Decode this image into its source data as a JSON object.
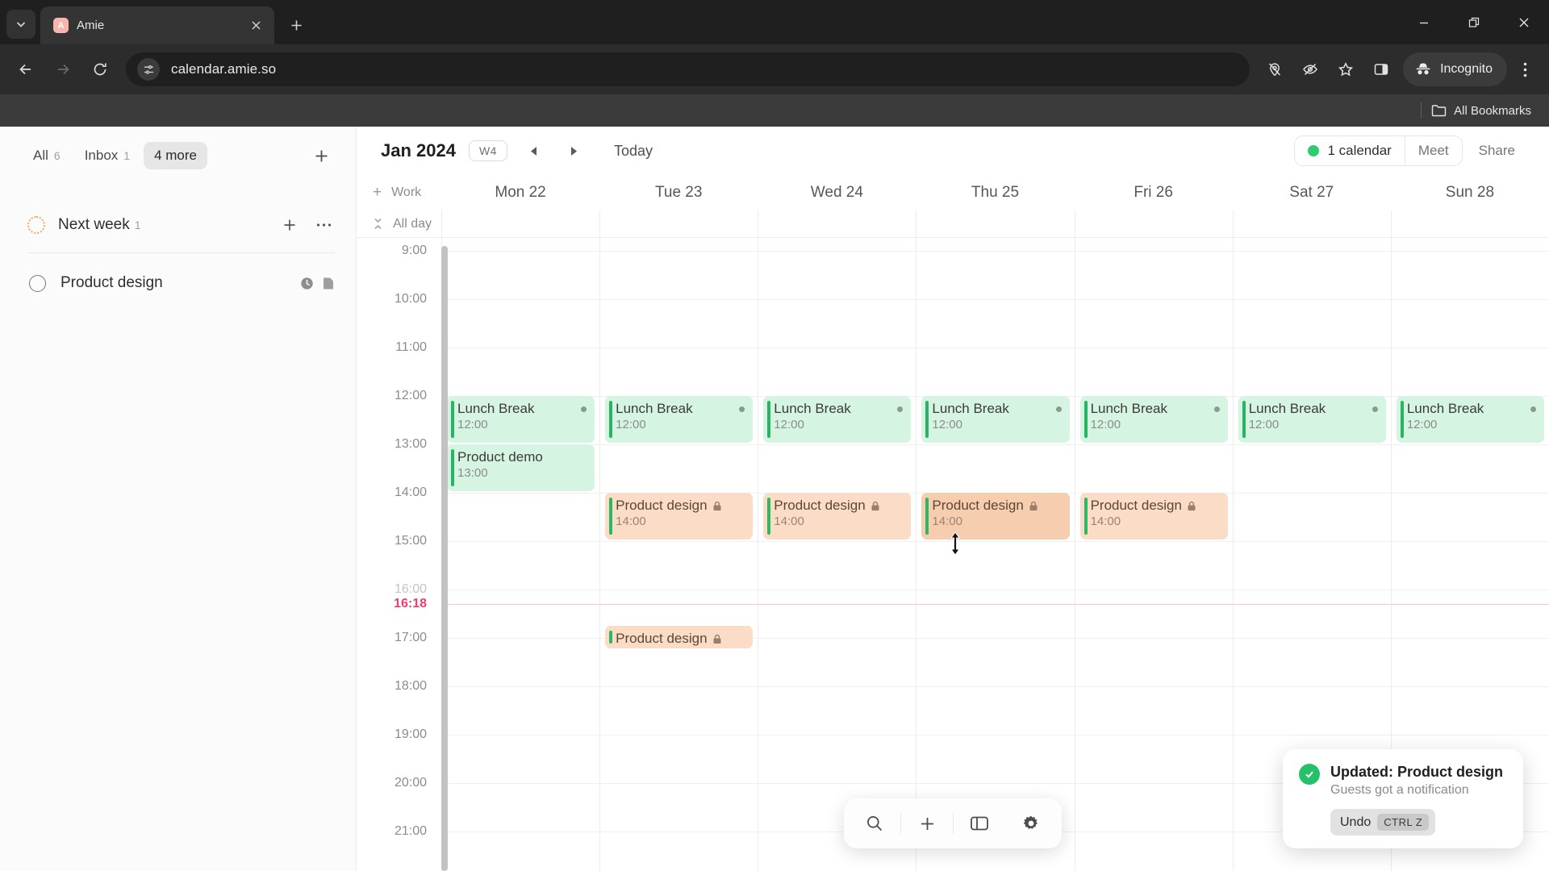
{
  "browser": {
    "tab": {
      "title": "Amie",
      "favicon_letter": "A",
      "favicon_color": "#f8b5b0"
    },
    "url": "calendar.amie.so",
    "incognito_label": "Incognito",
    "bookmarks_label": "All Bookmarks",
    "icons": {
      "tab_list": "chevron-down-icon",
      "close_tab": "close-icon",
      "new_tab": "plus-icon",
      "minimize": "minimize-icon",
      "restore": "restore-icon",
      "close_window": "close-icon",
      "back": "back-arrow-icon",
      "forward": "forward-arrow-icon",
      "reload": "reload-icon",
      "site_info": "site-settings-icon",
      "location_blocked": "location-off-icon",
      "tracking_blocked": "eye-off-icon",
      "bookmark": "star-icon",
      "side_panel": "side-panel-icon",
      "incognito": "incognito-hat-icon",
      "menu": "three-dots-vertical-icon",
      "bookmarks_folder": "folder-icon"
    }
  },
  "sidebar": {
    "tabs": [
      {
        "label": "All",
        "count": "6",
        "active": false
      },
      {
        "label": "Inbox",
        "count": "1",
        "active": false
      },
      {
        "label": "4 more",
        "count": "",
        "active": true
      }
    ],
    "add_label": "+",
    "group": {
      "title": "Next week",
      "count": "1",
      "add": "+",
      "more": "···"
    },
    "tasks": [
      {
        "label": "Product design",
        "icons": [
          "clock-icon",
          "doc-icon"
        ]
      }
    ]
  },
  "calendar": {
    "month": "Jan 2024",
    "week_badge": "W4",
    "today_label": "Today",
    "prev_label": "◀",
    "next_label": "▶",
    "calendars_label": "1 calendar",
    "calendars_dot_color": "#2ecc71",
    "meet_label": "Meet",
    "share_label": "Share",
    "work_label": "Work",
    "work_add": "+",
    "allday_label": "All day",
    "current_time": "16:18",
    "current_time_color": "#ef3f6b",
    "days": [
      {
        "label": "Mon 22"
      },
      {
        "label": "Tue 23"
      },
      {
        "label": "Wed 24"
      },
      {
        "label": "Thu 25"
      },
      {
        "label": "Fri 26"
      },
      {
        "label": "Sat 27"
      },
      {
        "label": "Sun 28"
      }
    ],
    "hours": [
      "9:00",
      "10:00",
      "11:00",
      "12:00",
      "13:00",
      "14:00",
      "15:00",
      "16:00",
      "17:00",
      "18:00",
      "19:00",
      "20:00",
      "21:00"
    ],
    "events": [
      {
        "day": 0,
        "title": "Lunch Break",
        "time": "12:00",
        "color": "green",
        "dot": true,
        "lock": false,
        "start": 12.0,
        "end": 13.0
      },
      {
        "day": 0,
        "title": "Product demo",
        "time": "13:00",
        "color": "green",
        "dot": false,
        "lock": false,
        "start": 13.0,
        "end": 14.0
      },
      {
        "day": 1,
        "title": "Lunch Break",
        "time": "12:00",
        "color": "green",
        "dot": true,
        "lock": false,
        "start": 12.0,
        "end": 13.0
      },
      {
        "day": 1,
        "title": "Product design",
        "time": "14:00",
        "color": "peach",
        "dot": false,
        "lock": true,
        "start": 14.0,
        "end": 15.0
      },
      {
        "day": 1,
        "title": "Product design",
        "time": "",
        "color": "peach",
        "dot": false,
        "lock": true,
        "start": 16.75,
        "end": 17.25
      },
      {
        "day": 2,
        "title": "Lunch Break",
        "time": "12:00",
        "color": "green",
        "dot": true,
        "lock": false,
        "start": 12.0,
        "end": 13.0
      },
      {
        "day": 2,
        "title": "Product design",
        "time": "14:00",
        "color": "peach",
        "dot": false,
        "lock": true,
        "start": 14.0,
        "end": 15.0
      },
      {
        "day": 3,
        "title": "Lunch Break",
        "time": "12:00",
        "color": "green",
        "dot": true,
        "lock": false,
        "start": 12.0,
        "end": 13.0
      },
      {
        "day": 3,
        "title": "Product design",
        "time": "14:00",
        "color": "selected",
        "dot": false,
        "lock": true,
        "start": 14.0,
        "end": 15.0
      },
      {
        "day": 4,
        "title": "Lunch Break",
        "time": "12:00",
        "color": "green",
        "dot": true,
        "lock": false,
        "start": 12.0,
        "end": 13.0
      },
      {
        "day": 4,
        "title": "Product design",
        "time": "14:00",
        "color": "peach",
        "dot": false,
        "lock": true,
        "start": 14.0,
        "end": 15.0
      },
      {
        "day": 5,
        "title": "Lunch Break",
        "time": "12:00",
        "color": "green",
        "dot": true,
        "lock": false,
        "start": 12.0,
        "end": 13.0
      },
      {
        "day": 6,
        "title": "Lunch Break",
        "time": "12:00",
        "color": "green",
        "dot": true,
        "lock": false,
        "start": 12.0,
        "end": 13.0
      }
    ]
  },
  "float_toolbar": {
    "buttons": [
      "search-icon",
      "plus-icon",
      "panel-icon",
      "gear-icon"
    ]
  },
  "toast": {
    "title": "Updated: Product design",
    "subtitle": "Guests got a notification",
    "undo_label": "Undo",
    "shortcut": "CTRL Z",
    "check_color": "#25c16a"
  }
}
